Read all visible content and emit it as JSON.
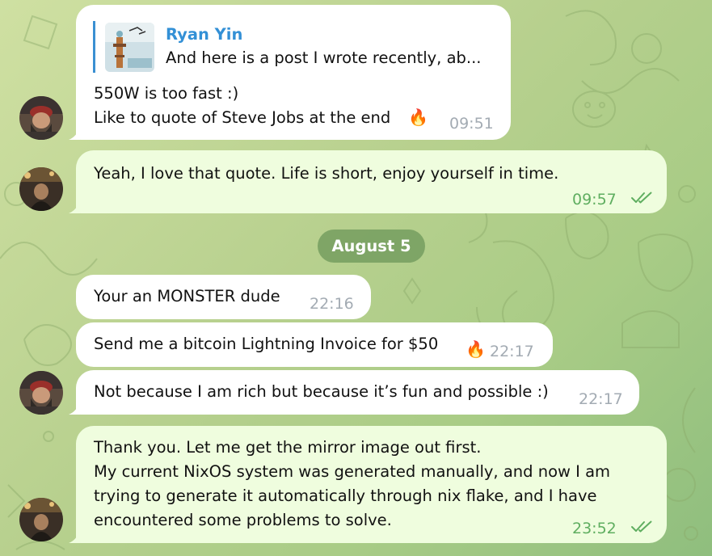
{
  "colors": {
    "incoming_bubble": "#ffffff",
    "outgoing_bubble": "#effdde",
    "outgoing_time": "#5fae60",
    "incoming_time": "#a3abb3",
    "reply_author": "#3390d6",
    "date_pill": "#6a9458"
  },
  "chat": {
    "date_separator": "August 5",
    "messages": [
      {
        "direction": "incoming",
        "reply": {
          "author": "Ryan Yin",
          "text": "And here is a post I wrote recently, ab..."
        },
        "lines": [
          "550W is too fast :)",
          "Like to quote of Steve Jobs at the end"
        ],
        "reaction": "fire-icon",
        "time": "09:51"
      },
      {
        "direction": "outgoing",
        "lines": [
          "Yeah, I love that quote. Life is short, enjoy yourself in time."
        ],
        "time": "09:57",
        "status": "read"
      },
      {
        "direction": "incoming",
        "lines": [
          "Your an MONSTER dude"
        ],
        "time": "22:16"
      },
      {
        "direction": "incoming",
        "lines": [
          "Send me a bitcoin Lightning Invoice for $50"
        ],
        "reaction": "fire-icon",
        "time": "22:17"
      },
      {
        "direction": "incoming",
        "lines": [
          "Not because I am rich but because it’s fun and possible :)"
        ],
        "time": "22:17"
      },
      {
        "direction": "outgoing",
        "lines": [
          "Thank you. Let me get the mirror image out first.",
          "My current NixOS system  was generated manually, and now I am",
          "trying to generate it automatically through nix flake, and I have",
          "encountered some problems to solve."
        ],
        "time": "23:52",
        "status": "read"
      }
    ]
  }
}
